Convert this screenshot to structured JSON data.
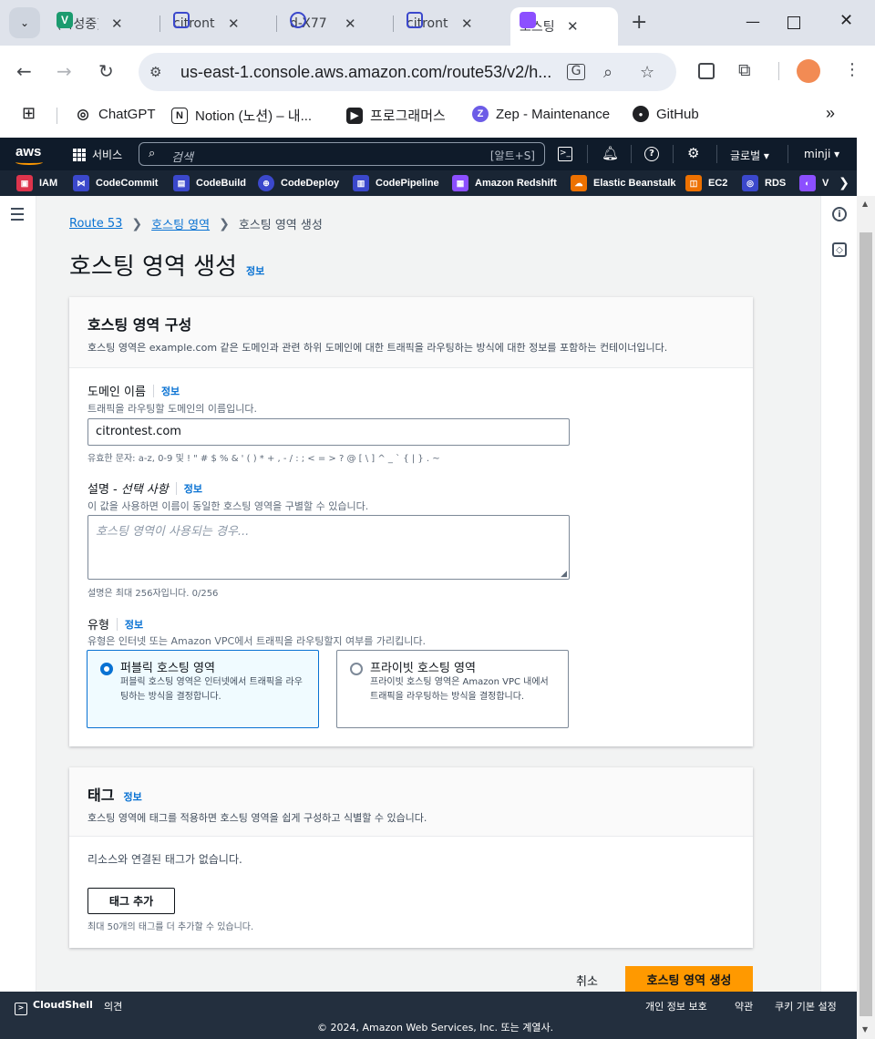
{
  "browser": {
    "tabs": [
      {
        "title": "(작성중)",
        "color": "#1b9b6f",
        "letter": "V"
      },
      {
        "title": "citrontest",
        "color": "#3b48cc",
        "letter": ""
      },
      {
        "title": "d-X77",
        "color": "#3b48cc",
        "letter": ""
      },
      {
        "title": "citrontest",
        "color": "#3b48cc",
        "letter": ""
      },
      {
        "title": "호스팅 영역",
        "color": "#8c4fff",
        "letter": ""
      }
    ],
    "url": "us-east-1.console.aws.amazon.com/route53/v2/h...",
    "bookmarks": [
      {
        "label": "ChatGPT",
        "color": "#202124",
        "letter": "◎"
      },
      {
        "label": "Notion (노션) – 내...",
        "color": "#202124",
        "letter": "N"
      },
      {
        "label": "프로그래머스",
        "color": "#202124",
        "letter": "▶"
      },
      {
        "label": "Zep - Maintenance",
        "color": "#6c5ce7",
        "letter": "Z"
      },
      {
        "label": "GitHub",
        "color": "#202124",
        "letter": "●"
      }
    ]
  },
  "awsnav": {
    "logo": "aws",
    "services": "서비스",
    "search_placeholder": "검색",
    "search_shortcut": "[알트+S]",
    "region": "글로벌 ▾",
    "user": "minji ▾"
  },
  "favorites": [
    {
      "label": "IAM",
      "color": "#dd344c"
    },
    {
      "label": "CodeCommit",
      "color": "#3b48cc"
    },
    {
      "label": "CodeBuild",
      "color": "#3b48cc"
    },
    {
      "label": "CodeDeploy",
      "color": "#3b48cc"
    },
    {
      "label": "CodePipeline",
      "color": "#3b48cc"
    },
    {
      "label": "Amazon Redshift",
      "color": "#8c4fff"
    },
    {
      "label": "Elastic Beanstalk",
      "color": "#ed7100"
    },
    {
      "label": "EC2",
      "color": "#ed7100"
    },
    {
      "label": "RDS",
      "color": "#3b48cc"
    },
    {
      "label": "V",
      "color": "#8c4fff"
    }
  ],
  "breadcrumb": {
    "root": "Route 53",
    "parent": "호스팅 영역",
    "current": "호스팅 영역 생성"
  },
  "page": {
    "title": "호스팅 영역 생성",
    "info": "정보"
  },
  "config_panel": {
    "title": "호스팅 영역 구성",
    "desc": "호스팅 영역은 example.com 같은 도메인과 관련 하위 도메인에 대한 트래픽을 라우팅하는 방식에 대한 정보를 포함하는 컨테이너입니다.",
    "domain": {
      "label": "도메인 이름",
      "info": "정보",
      "desc": "트래픽을 라우팅할 도메인의 이름입니다.",
      "value": "citrontest.com",
      "hint": "유효한 문자: a-z, 0-9 및 ! \" # $ % & ' ( ) * + , - / : ; < = > ? @ [ \\ ] ^ _ ` { | } . ~"
    },
    "description": {
      "label": "설명 - ",
      "label_optional": "선택 사항",
      "info": "정보",
      "desc": "이 값을 사용하면 이름이 동일한 호스팅 영역을 구별할 수 있습니다.",
      "placeholder": "호스팅 영역이 사용되는 경우...",
      "hint": "설명은 최대 256자입니다. 0/256"
    },
    "type": {
      "label": "유형",
      "info": "정보",
      "desc": "유형은 인터넷 또는 Amazon VPC에서 트래픽을 라우팅할지 여부를 가리킵니다.",
      "options": [
        {
          "title": "퍼블릭 호스팅 영역",
          "desc": "퍼블릭 호스팅 영역은 인터넷에서 트래픽을 라우팅하는 방식을 결정합니다.",
          "selected": true
        },
        {
          "title": "프라이빗 호스팅 영역",
          "desc": "프라이빗 호스팅 영역은 Amazon VPC 내에서 트래픽을 라우팅하는 방식을 결정합니다.",
          "selected": false
        }
      ]
    }
  },
  "tags_panel": {
    "title": "태그",
    "info": "정보",
    "desc": "호스팅 영역에 태그를 적용하면 호스팅 영역을 쉽게 구성하고 식별할 수 있습니다.",
    "empty": "리소스와 연결된 태그가 없습니다.",
    "add_button": "태그 추가",
    "limit": "최대 50개의 태그를 더 추가할 수 있습니다."
  },
  "actions": {
    "cancel": "취소",
    "submit": "호스팅 영역 생성"
  },
  "footer": {
    "cloudshell": "CloudShell",
    "feedback": "의견",
    "privacy": "개인 정보 보호",
    "terms": "약관",
    "cookies": "쿠키 기본 설정",
    "copyright": "© 2024, Amazon Web Services, Inc. 또는 계열사."
  }
}
